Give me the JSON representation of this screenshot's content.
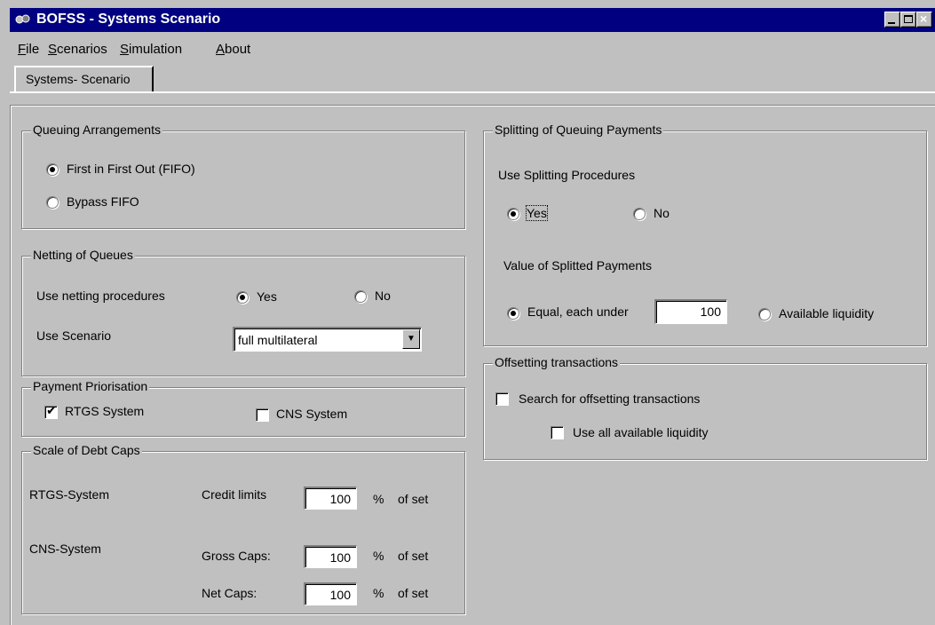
{
  "window": {
    "title": "BOFSS - Systems Scenario"
  },
  "menu": {
    "file": "File",
    "scenarios": "Scenarios",
    "simulation": "Simulation",
    "about": "About"
  },
  "tab": {
    "label": "Systems- Scenario"
  },
  "queuing": {
    "caption": "Queuing Arrangements",
    "fifo": "First in First Out (FIFO)",
    "bypass": "Bypass FIFO",
    "selected": "fifo"
  },
  "netting": {
    "caption": "Netting of Queues",
    "use_label": "Use netting procedures",
    "yes": "Yes",
    "no": "No",
    "selected": "yes",
    "scenario_label": "Use Scenario",
    "scenario_value": "full multilateral"
  },
  "priorisation": {
    "caption": "Payment Priorisation",
    "rtgs": "RTGS System",
    "cns": "CNS System",
    "rtgs_checked": true,
    "cns_checked": false
  },
  "debtcaps": {
    "caption": "Scale of Debt Caps",
    "rtgs_system": "RTGS-System",
    "cns_system": "CNS-System",
    "credit_limits": "Credit limits",
    "gross_caps": "Gross Caps:",
    "net_caps": "Net Caps:",
    "credit_value": "100",
    "gross_value": "100",
    "net_value": "100",
    "pct1": "%",
    "of_set1": "of set",
    "pct2": "%",
    "of_set2": "of set",
    "pct3": "%",
    "of_set3": "of set"
  },
  "splitting": {
    "caption": "Splitting of Queuing Payments",
    "use_label": "Use Splitting Procedures",
    "yes": "Yes",
    "no": "No",
    "selected": "yes",
    "value_label": "Value of Splitted Payments",
    "equal": "Equal, each under",
    "equal_value": "100",
    "available": "Available liquidity"
  },
  "offsetting": {
    "caption": "Offsetting transactions",
    "search": "Search for offsetting transactions",
    "use_all": "Use all available liquidity",
    "search_checked": false,
    "use_all_checked": false
  },
  "colors": {
    "titlebar": "#000080",
    "face": "#c0c0c0"
  }
}
